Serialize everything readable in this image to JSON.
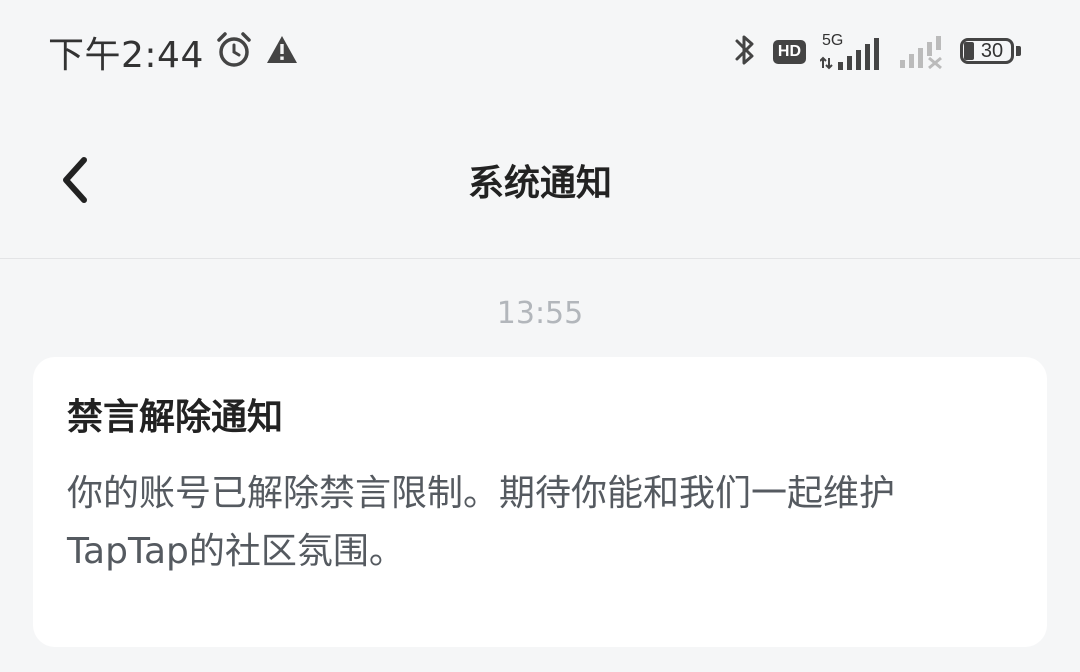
{
  "status_bar": {
    "time": "下午2:44",
    "icons": {
      "alarm": "alarm-clock-icon",
      "warning": "warning-triangle-icon",
      "bluetooth": "bluetooth-icon",
      "hd": "HD",
      "network": "5G",
      "signal_1": "signal-bars-icon",
      "signal_2": "no-signal-icon"
    },
    "battery_level": "30"
  },
  "header": {
    "back_icon": "chevron-left-icon",
    "title": "系统通知"
  },
  "messages": [
    {
      "time": "13:55",
      "title": "禁言解除通知",
      "body": "你的账号已解除禁言限制。期待你能和我们一起维护TapTap的社区氛围。"
    }
  ],
  "colors": {
    "background": "#f5f6f7",
    "card": "#ffffff",
    "title_text": "#222222",
    "body_text": "#555a60",
    "timestamp_text": "#b2b6bb"
  }
}
